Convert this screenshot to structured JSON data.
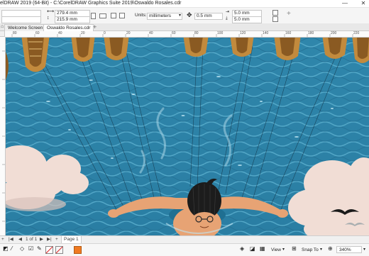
{
  "window": {
    "title": "elDRAW 2019 (64-Bit) - C:\\CorelDRAW Graphics Suite 2019\\Oswaldo Rosales.cdr",
    "minimize": "—",
    "close": "✕"
  },
  "propbar": {
    "width": "279.4 mm",
    "height": "215.9 mm",
    "units_label": "Units:",
    "units_value": "millimeters",
    "nudge": "0.5 mm",
    "dup_x": "5.0 mm",
    "dup_y": "5.0 mm",
    "add": "+"
  },
  "tabs": {
    "items": [
      {
        "label": "Welcome Screen"
      },
      {
        "label": "Oswaldo Rosales.cdr"
      }
    ],
    "add": "+"
  },
  "ruler": {
    "ticks": [
      "80",
      "60",
      "40",
      "20",
      "0",
      "20",
      "40",
      "60",
      "80",
      "100",
      "120",
      "140",
      "160",
      "180",
      "200",
      "220"
    ]
  },
  "pagebar": {
    "first": "|◀",
    "prev": "◀",
    "page_info": "1 of 1",
    "next": "▶",
    "last": "▶|",
    "add_page": "+",
    "page_tab": "Page 1"
  },
  "statusbar": {
    "view_label": "View",
    "snap_label": "Snap To",
    "zoom": "340%",
    "fill_color": "#f07a22",
    "outline_color": "#ffffff"
  },
  "colors": {
    "sea": "#2c7fa3",
    "sea_light": "#4fa7c8",
    "sea_dark": "#1d5f80",
    "skin": "#e7a374",
    "hair": "#1c1c1c",
    "cloud": "#f1ddd5",
    "boat": "#c28a3d",
    "boat_dark": "#6e4213"
  }
}
